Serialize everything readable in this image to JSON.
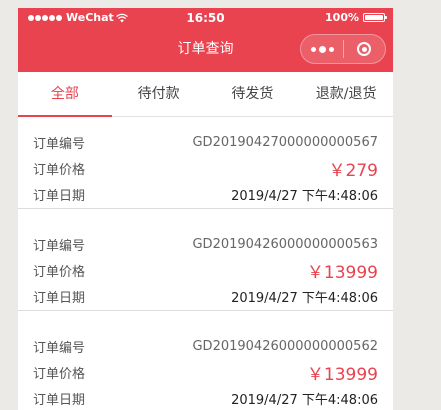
{
  "status_bar": {
    "carrier": "WeChat",
    "time": "16:50",
    "battery": "100%"
  },
  "nav": {
    "title": "订单查询"
  },
  "tabs": [
    {
      "label": "全部",
      "active": true
    },
    {
      "label": "待付款",
      "active": false
    },
    {
      "label": "待发货",
      "active": false
    },
    {
      "label": "退款/退货",
      "active": false
    }
  ],
  "labels": {
    "order_no": "订单编号",
    "price": "订单价格",
    "date": "订单日期"
  },
  "orders": [
    {
      "order_no": "GD20190427000000000567",
      "price": "￥279",
      "date": "2019/4/27 下午4:48:06"
    },
    {
      "order_no": "GD20190426000000000563",
      "price": "￥13999",
      "date": "2019/4/27 下午4:48:06"
    },
    {
      "order_no": "GD20190426000000000562",
      "price": "￥13999",
      "date": "2019/4/27 下午4:48:06"
    }
  ],
  "colors": {
    "accent": "#e8434f",
    "background": "#eceae6"
  },
  "icons": [
    "wifi-icon",
    "battery-icon",
    "more-icon",
    "close-circle-icon"
  ]
}
